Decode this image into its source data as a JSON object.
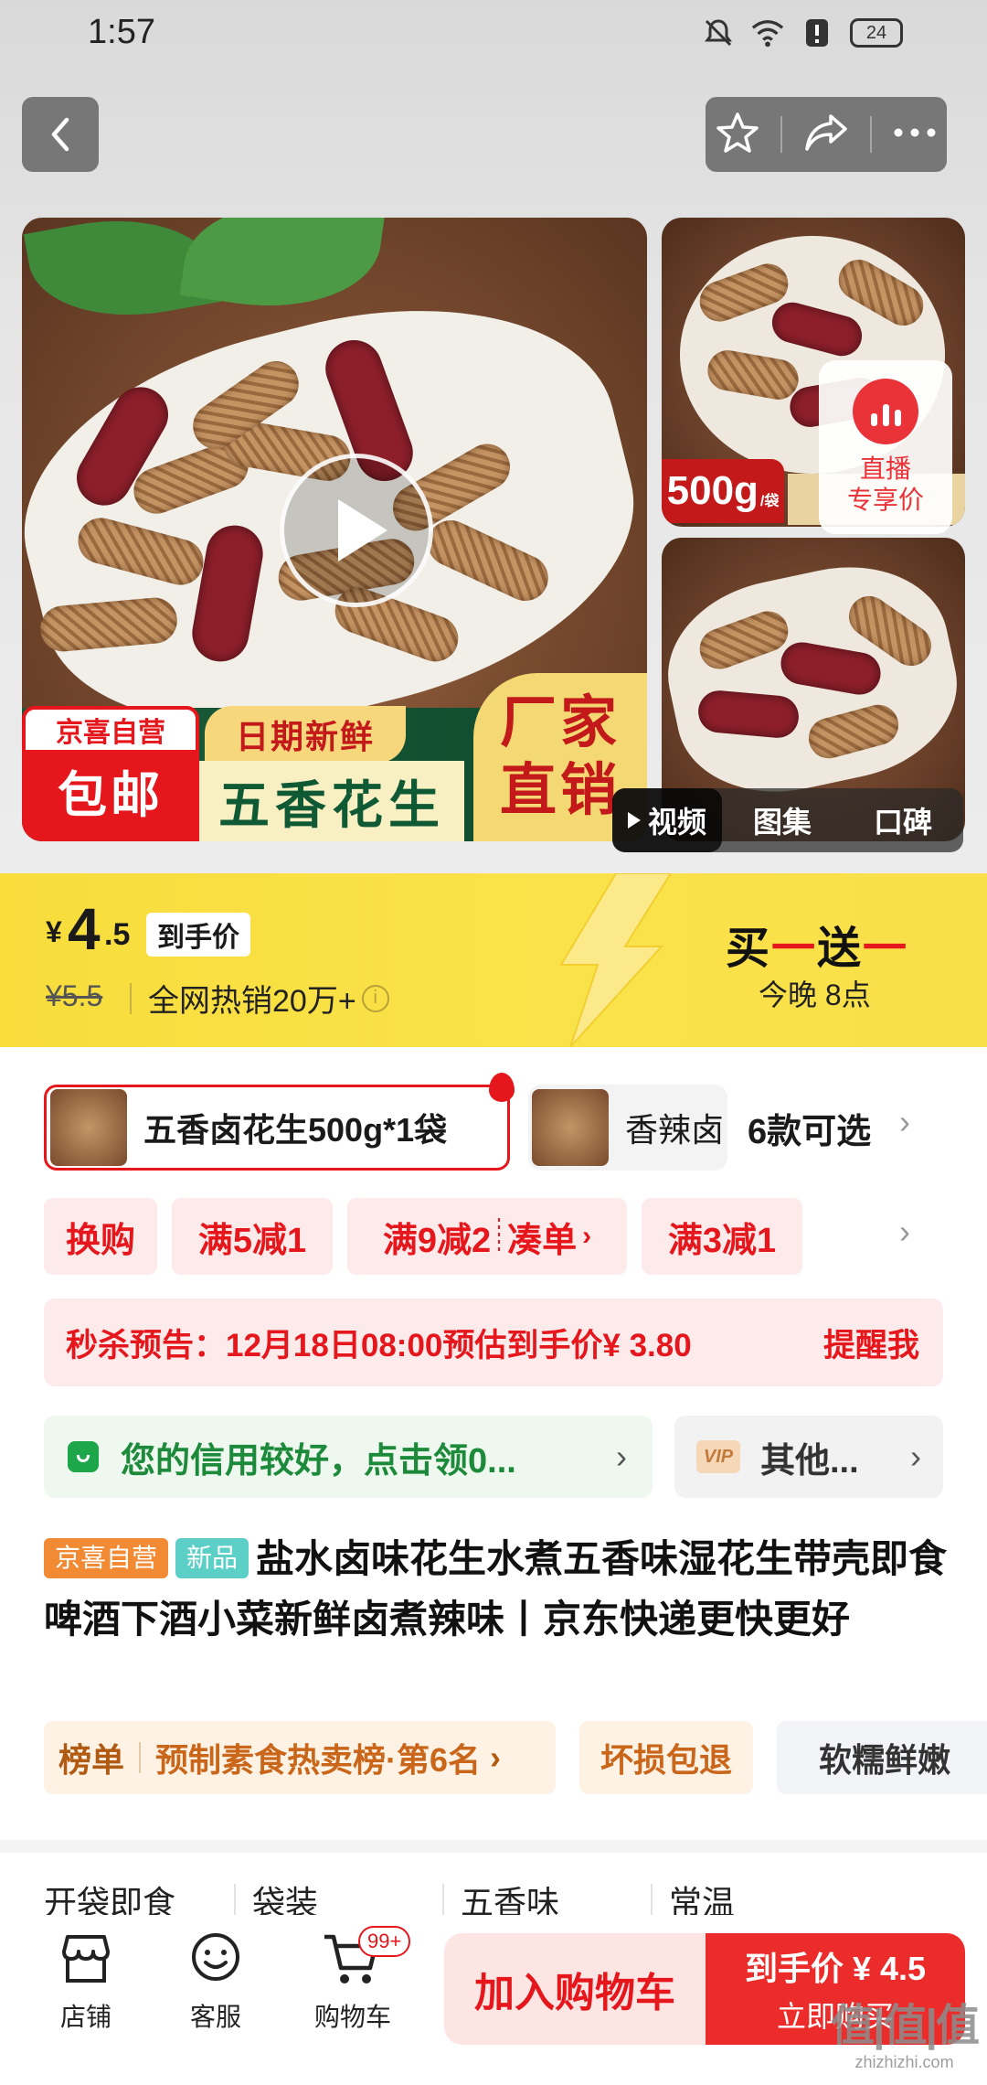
{
  "status_bar": {
    "time": "1:57",
    "battery": "24"
  },
  "icons": {
    "back": "back-arrow-icon",
    "favorite": "star-icon",
    "share": "share-icon",
    "more": "more-icon"
  },
  "gallery": {
    "main_badge_top": "京喜自营",
    "main_badge_bottom": "包邮",
    "date_tag": "日期新鲜",
    "product_name_banner": "五香花生",
    "direct_sale_line1": "厂家",
    "direct_sale_line2": "直销",
    "weight_tag": "500g",
    "weight_unit": "/袋",
    "live_label_line1": "直播",
    "live_label_line2": "专享价",
    "tabs": [
      "视频",
      "图集",
      "口碑"
    ]
  },
  "price_banner": {
    "currency": "¥",
    "price_int": "4",
    "price_dec": ".5",
    "price_tag": "到手价",
    "original_price": "¥5.5",
    "hot_sale": "全网热销20万+",
    "promo_part1": "买",
    "promo_red1": "一",
    "promo_part2": "送",
    "promo_red2": "一",
    "promo_time": "今晚 8点",
    "colors": {
      "banner": "#f9e04a",
      "accent": "#e5171c"
    }
  },
  "sku": {
    "selected": "五香卤花生500g*1袋",
    "other": "香辣卤",
    "count": "6款可选"
  },
  "promo_tags": {
    "swap": "换购",
    "t1": "满5减1",
    "t2": "满9减2",
    "t2_action": "凑单",
    "t3": "满3减1"
  },
  "seckill": {
    "text": "秒杀预告：12月18日08:00预估到手价¥ 3.80",
    "remind": "提醒我"
  },
  "credit": {
    "text": "您的信用较好，点击领0...",
    "vip_badge": "VIP",
    "vip_text": "其他..."
  },
  "title": {
    "badge_jx": "京喜自营",
    "badge_new": "新品",
    "text": "盐水卤味花生水煮五香味湿花生带壳即食啤酒下酒小菜新鲜卤煮辣味丨京东快递更快更好"
  },
  "rank": {
    "label": "榜单",
    "text": "预制素食热卖榜·第6名",
    "guarantee": "坏损包退",
    "feature": "软糯鲜嫩"
  },
  "attributes": [
    "开袋即食",
    "袋装",
    "五香味",
    "常温"
  ],
  "bottom_bar": {
    "store": "店铺",
    "service": "客服",
    "cart": "购物车",
    "cart_badge": "99+",
    "add_to_cart": "加入购物车",
    "buy_price": "到手价 ¥ 4.5",
    "buy_label": "立即购买"
  },
  "watermark": {
    "big": "值|值|值",
    "small": "zhizhizhi.com"
  }
}
